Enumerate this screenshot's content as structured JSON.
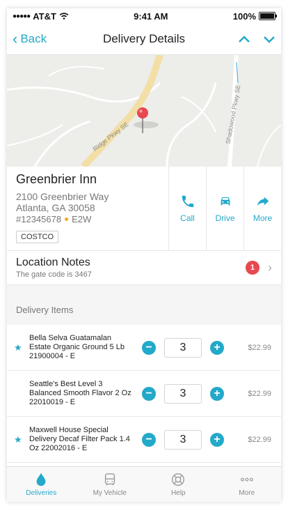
{
  "status_bar": {
    "carrier": "AT&T",
    "time": "9:41 AM",
    "battery": "100%"
  },
  "nav": {
    "back_label": "Back",
    "title": "Delivery Details"
  },
  "map": {
    "road_labels": [
      "Ridge Pkwy SE",
      "Shadowood Pkwy SE"
    ]
  },
  "stop": {
    "name": "Greenbrier Inn",
    "address_line1": "2100 Greenbrier Way",
    "address_line2": "Atlanta, GA 30058",
    "order_number": "#12345678",
    "route_code": "E2W",
    "tag": "COSTCO"
  },
  "actions": [
    {
      "label": "Call",
      "icon": "phone-icon"
    },
    {
      "label": "Drive",
      "icon": "car-icon"
    },
    {
      "label": "More",
      "icon": "share-arrow-icon"
    }
  ],
  "location_notes": {
    "title": "Location Notes",
    "subtitle": "The gate code is 3467",
    "badge_count": "1"
  },
  "delivery_items": {
    "header": "Delivery Items",
    "items": [
      {
        "starred": true,
        "description": "Bella Selva Guatamalan Estate Organic Ground 5 Lb 21900004 - E",
        "quantity": "3",
        "price": "$22.99"
      },
      {
        "starred": false,
        "description": "Seattle's Best Level 3 Balanced Smooth Flavor 2 Oz 22010019 - E",
        "quantity": "3",
        "price": "$22.99"
      },
      {
        "starred": true,
        "description": "Maxwell House Special Delivery Decaf Filter Pack 1.4 Oz 22002016 - E",
        "quantity": "3",
        "price": "$22.99"
      }
    ]
  },
  "tabbar": [
    {
      "label": "Deliveries",
      "icon": "drop-icon",
      "active": true
    },
    {
      "label": "My Vehicle",
      "icon": "bus-icon",
      "active": false
    },
    {
      "label": "Help",
      "icon": "lifebuoy-icon",
      "active": false
    },
    {
      "label": "More",
      "icon": "ellipsis-icon",
      "active": false
    }
  ],
  "colors": {
    "accent": "#23a9c9",
    "badge": "#e8484f",
    "pin": "#e8484f"
  }
}
